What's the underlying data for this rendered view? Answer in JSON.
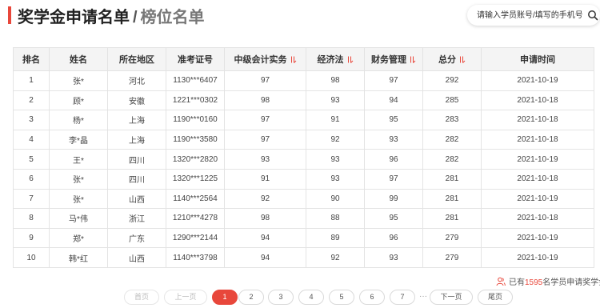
{
  "header": {
    "title": "奖学金申请名单",
    "separator": "/",
    "subtitle": "榜位名单"
  },
  "search": {
    "placeholder": "请输入学员账号/填写的手机号",
    "icon": "search-icon"
  },
  "table": {
    "headers": {
      "rank": "排名",
      "name": "姓名",
      "region": "所在地区",
      "ticket": "准考证号",
      "accounting": "中级会计实务",
      "law": "经济法",
      "finance": "财务管理",
      "total": "总分",
      "date": "申请时间"
    },
    "sort_icon_color": "#e8473b",
    "rows": [
      {
        "rank": "1",
        "name": "张*",
        "region": "河北",
        "ticket": "1130***6407",
        "accounting": "97",
        "law": "98",
        "finance": "97",
        "total": "292",
        "date": "2021-10-19"
      },
      {
        "rank": "2",
        "name": "顾*",
        "region": "安徽",
        "ticket": "1221***0302",
        "accounting": "98",
        "law": "93",
        "finance": "94",
        "total": "285",
        "date": "2021-10-18"
      },
      {
        "rank": "3",
        "name": "杨*",
        "region": "上海",
        "ticket": "1190***0160",
        "accounting": "97",
        "law": "91",
        "finance": "95",
        "total": "283",
        "date": "2021-10-18"
      },
      {
        "rank": "4",
        "name": "李*晶",
        "region": "上海",
        "ticket": "1190***3580",
        "accounting": "97",
        "law": "92",
        "finance": "93",
        "total": "282",
        "date": "2021-10-18"
      },
      {
        "rank": "5",
        "name": "王*",
        "region": "四川",
        "ticket": "1320***2820",
        "accounting": "93",
        "law": "93",
        "finance": "96",
        "total": "282",
        "date": "2021-10-19"
      },
      {
        "rank": "6",
        "name": "张*",
        "region": "四川",
        "ticket": "1320***1225",
        "accounting": "91",
        "law": "93",
        "finance": "97",
        "total": "281",
        "date": "2021-10-18"
      },
      {
        "rank": "7",
        "name": "张*",
        "region": "山西",
        "ticket": "1140***2564",
        "accounting": "92",
        "law": "90",
        "finance": "99",
        "total": "281",
        "date": "2021-10-19"
      },
      {
        "rank": "8",
        "name": "马*伟",
        "region": "浙江",
        "ticket": "1210***4278",
        "accounting": "98",
        "law": "88",
        "finance": "95",
        "total": "281",
        "date": "2021-10-18"
      },
      {
        "rank": "9",
        "name": "郑*",
        "region": "广东",
        "ticket": "1290***2144",
        "accounting": "94",
        "law": "89",
        "finance": "96",
        "total": "279",
        "date": "2021-10-19"
      },
      {
        "rank": "10",
        "name": "韩*红",
        "region": "山西",
        "ticket": "1140***3798",
        "accounting": "94",
        "law": "92",
        "finance": "93",
        "total": "279",
        "date": "2021-10-19"
      }
    ]
  },
  "footer": {
    "prefix": "已有",
    "count": "1595",
    "suffix": "名学员申请奖学金",
    "icon": "users-icon"
  },
  "pagination": {
    "first": "首页",
    "prev": "上一页",
    "pages": [
      "1",
      "2",
      "3",
      "4",
      "5",
      "6",
      "7"
    ],
    "current": "1",
    "ellipsis": "···",
    "next": "下一页",
    "last": "尾页"
  },
  "colors": {
    "accent": "#e8473b",
    "header_bg": "#f4f4f4"
  }
}
